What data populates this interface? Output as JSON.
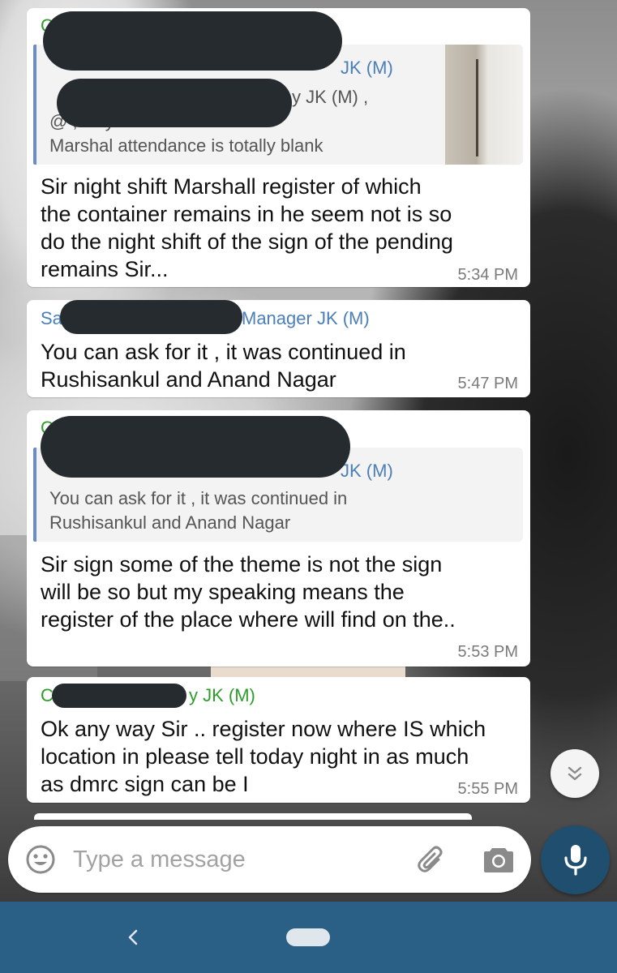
{
  "messages": [
    {
      "sender": "C",
      "quote": {
        "name": "JK (M)",
        "lines": [
          "y JK (M) ,",
          "@ , why C shift",
          "Marshal attendance is totally blank"
        ]
      },
      "lines": [
        "Sir night shift Marshall register of which",
        "the container remains in he seem not is so",
        "do the night shift of the sign of the pending",
        "remains Sir..."
      ],
      "time": "5:34 PM"
    },
    {
      "sender_prefix": "Sa",
      "sender_suffix": "Manager JK (M)",
      "lines": [
        "You can ask for it , it was continued in",
        "Rushisankul and Anand Nagar"
      ],
      "time": "5:47 PM"
    },
    {
      "sender": "C",
      "quote": {
        "name": "JK (M)",
        "lines": [
          "You can ask for it , it was continued in",
          "Rushisankul and Anand Nagar"
        ]
      },
      "lines": [
        "Sir sign some of the theme is not the sign",
        "will be so but my speaking means the",
        "register of the place where will find on the.."
      ],
      "time": "5:53 PM"
    },
    {
      "sender_prefix": "C",
      "sender_suffix": "y JK (M)",
      "lines": [
        "Ok any way Sir .. register now where IS which",
        "location in please tell today night in as much",
        "as dmrc  sign can be I"
      ],
      "time": "5:55 PM"
    }
  ],
  "input": {
    "placeholder": "Type a message",
    "value": ""
  },
  "icons": {
    "emoji": "emoji-icon",
    "attach": "paperclip-icon",
    "camera": "camera-icon",
    "mic": "microphone-icon",
    "scroll_down": "double-chevron-down-icon",
    "nav_back": "back-chevron-icon",
    "nav_home": "home-pill-icon"
  },
  "colors": {
    "sender_green": "#2e9d2a",
    "sender_blue": "#4b7fb8",
    "nav_bar": "#2a5f86",
    "mic_button": "#1f4e6e"
  }
}
